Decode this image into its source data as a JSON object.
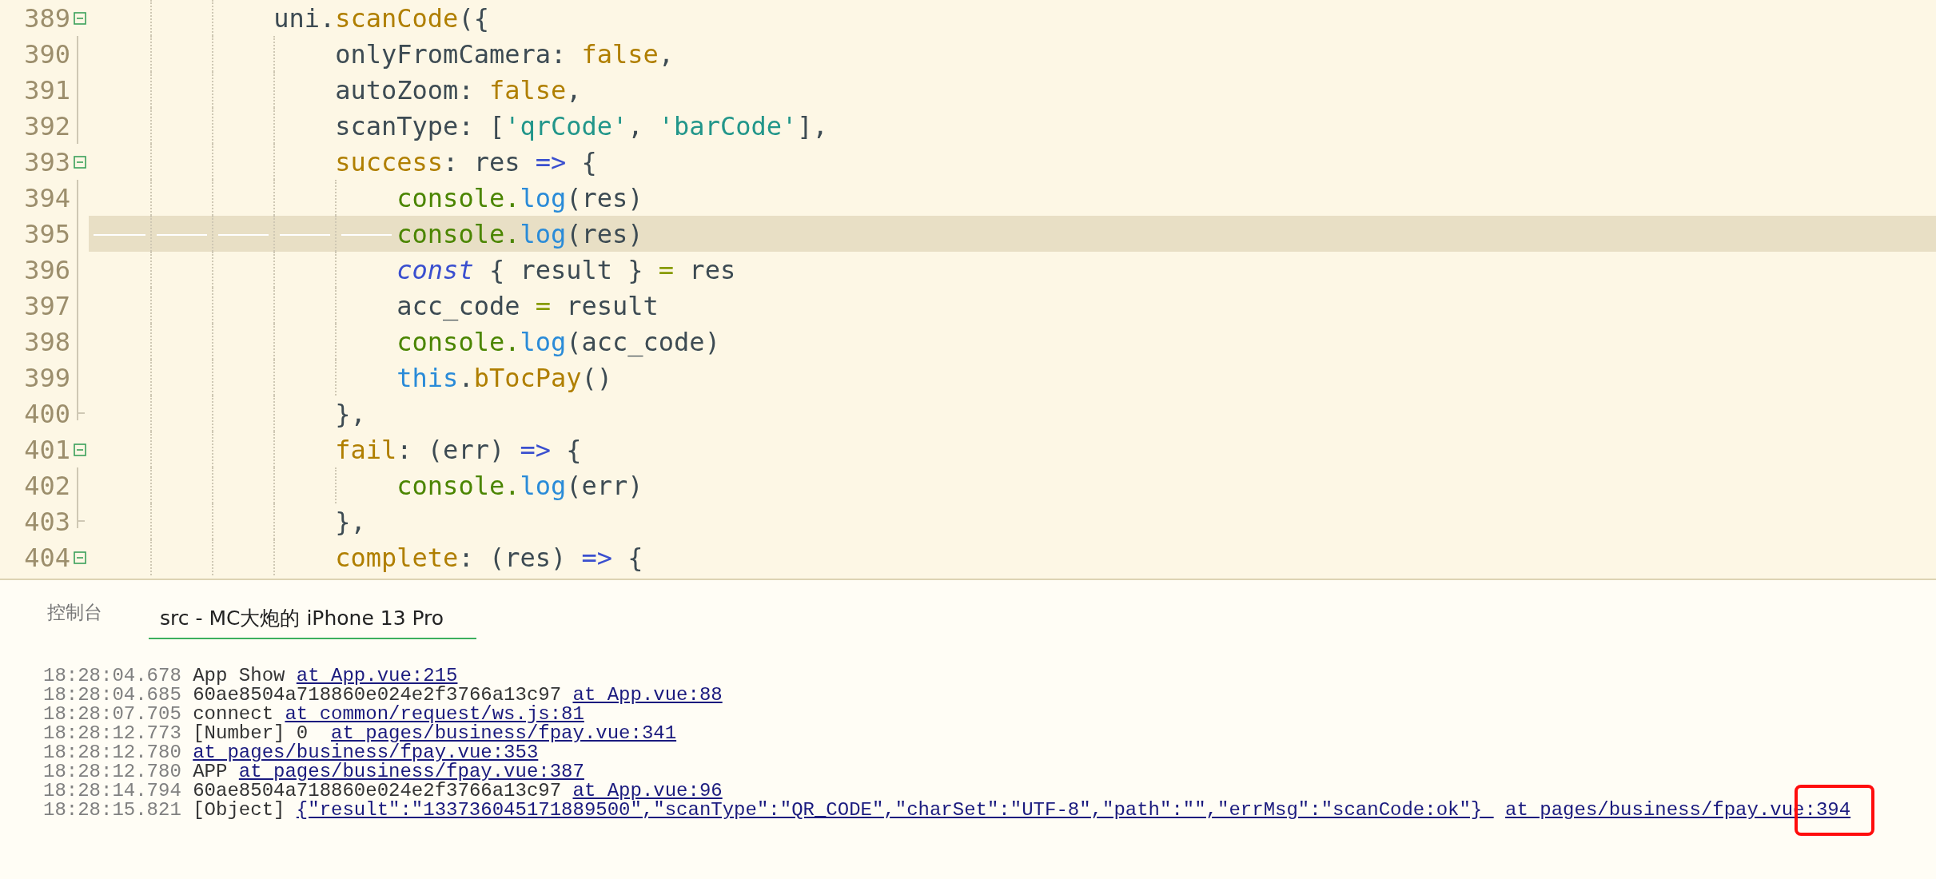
{
  "editor": {
    "lines": [
      {
        "number": "389",
        "foldable": true,
        "highlighted": false,
        "tokens": [
          {
            "t": "uni.",
            "kind": "plain"
          },
          {
            "t": "scanCode",
            "kind": "prop"
          },
          {
            "t": "({",
            "kind": "plain"
          }
        ],
        "children": [
          {
            "number": "390",
            "foldable": false,
            "highlighted": false,
            "tokens": [
              {
                "t": "onlyFromCamera: ",
                "kind": "plain"
              },
              {
                "t": "false",
                "kind": "prop"
              },
              {
                "t": ",",
                "kind": "plain"
              }
            ]
          },
          {
            "number": "391",
            "foldable": false,
            "highlighted": false,
            "tokens": [
              {
                "t": "autoZoom: ",
                "kind": "plain"
              },
              {
                "t": "false",
                "kind": "prop"
              },
              {
                "t": ",",
                "kind": "plain"
              }
            ]
          },
          {
            "number": "392",
            "foldable": false,
            "highlighted": false,
            "tokens": [
              {
                "t": "scanType: [",
                "kind": "plain"
              },
              {
                "t": "'qrCode'",
                "kind": "string"
              },
              {
                "t": ", ",
                "kind": "plain"
              },
              {
                "t": "'barCode'",
                "kind": "string"
              },
              {
                "t": "],",
                "kind": "plain"
              }
            ]
          },
          {
            "number": "393",
            "foldable": true,
            "highlighted": false,
            "tokens": [
              {
                "t": "success",
                "kind": "prop"
              },
              {
                "t": ": res ",
                "kind": "plain"
              },
              {
                "t": "=>",
                "kind": "arrow"
              },
              {
                "t": " {",
                "kind": "plain"
              }
            ],
            "children": [
              {
                "number": "394",
                "foldable": false,
                "highlighted": false,
                "tokens": [
                  {
                    "t": "console.",
                    "kind": "object"
                  },
                  {
                    "t": "log",
                    "kind": "func"
                  },
                  {
                    "t": "(res)",
                    "kind": "plain"
                  }
                ]
              },
              {
                "number": "395",
                "foldable": false,
                "highlighted": true,
                "tokens": [
                  {
                    "t": "console.",
                    "kind": "object"
                  },
                  {
                    "t": "log",
                    "kind": "func"
                  },
                  {
                    "t": "(res)",
                    "kind": "plain"
                  }
                ]
              },
              {
                "number": "396",
                "foldable": false,
                "highlighted": false,
                "tokens": [
                  {
                    "t": "const",
                    "kind": "keyword"
                  },
                  {
                    "t": " { result } ",
                    "kind": "plain"
                  },
                  {
                    "t": "=",
                    "kind": "op"
                  },
                  {
                    "t": " res",
                    "kind": "plain"
                  }
                ]
              },
              {
                "number": "397",
                "foldable": false,
                "highlighted": false,
                "tokens": [
                  {
                    "t": "acc_code ",
                    "kind": "plain"
                  },
                  {
                    "t": "=",
                    "kind": "op"
                  },
                  {
                    "t": " result",
                    "kind": "plain"
                  }
                ]
              },
              {
                "number": "398",
                "foldable": false,
                "highlighted": false,
                "tokens": [
                  {
                    "t": "console.",
                    "kind": "object"
                  },
                  {
                    "t": "log",
                    "kind": "func"
                  },
                  {
                    "t": "(acc_code)",
                    "kind": "plain"
                  }
                ]
              },
              {
                "number": "399",
                "foldable": false,
                "highlighted": false,
                "tokens": [
                  {
                    "t": "this",
                    "kind": "func"
                  },
                  {
                    "t": ".",
                    "kind": "plain"
                  },
                  {
                    "t": "bTocPay",
                    "kind": "prop"
                  },
                  {
                    "t": "()",
                    "kind": "plain"
                  }
                ]
              }
            ]
          },
          {
            "number": "400",
            "foldable": false,
            "fold_end": true,
            "highlighted": false,
            "tokens": [
              {
                "t": "},",
                "kind": "plain"
              }
            ]
          },
          {
            "number": "401",
            "foldable": true,
            "highlighted": false,
            "tokens": [
              {
                "t": "fail",
                "kind": "prop"
              },
              {
                "t": ": (err) ",
                "kind": "plain"
              },
              {
                "t": "=>",
                "kind": "arrow"
              },
              {
                "t": " {",
                "kind": "plain"
              }
            ],
            "children": [
              {
                "number": "402",
                "foldable": false,
                "highlighted": false,
                "tokens": [
                  {
                    "t": "console.",
                    "kind": "object"
                  },
                  {
                    "t": "log",
                    "kind": "func"
                  },
                  {
                    "t": "(err)",
                    "kind": "plain"
                  }
                ]
              }
            ]
          },
          {
            "number": "403",
            "foldable": false,
            "fold_end": true,
            "highlighted": false,
            "tokens": [
              {
                "t": "},",
                "kind": "plain"
              }
            ]
          },
          {
            "number": "404",
            "foldable": true,
            "highlighted": false,
            "tokens": [
              {
                "t": "complete",
                "kind": "prop"
              },
              {
                "t": ": (res) ",
                "kind": "plain"
              },
              {
                "t": "=>",
                "kind": "arrow"
              },
              {
                "t": " {",
                "kind": "plain"
              }
            ]
          }
        ]
      }
    ]
  },
  "console": {
    "title": "控制台",
    "tabs": [
      {
        "label": "src - MC大炮的 iPhone 13 Pro",
        "selected": true
      }
    ],
    "entries": [
      {
        "time": "18:28:04.678",
        "parts": [
          {
            "t": "App Show",
            "kind": "text"
          },
          {
            "t": "at App.vue:215",
            "kind": "link"
          }
        ]
      },
      {
        "time": "18:28:04.685",
        "parts": [
          {
            "t": "60ae8504a718860e024e2f3766a13c97",
            "kind": "text"
          },
          {
            "t": "at App.vue:88",
            "kind": "link"
          }
        ]
      },
      {
        "time": "18:28:07.705",
        "parts": [
          {
            "t": "connect",
            "kind": "text"
          },
          {
            "t": "at common/request/ws.js:81",
            "kind": "link"
          }
        ]
      },
      {
        "time": "18:28:12.773",
        "parts": [
          {
            "t": "[Number] 0 ",
            "kind": "text"
          },
          {
            "t": "at pages/business/fpay.vue:341",
            "kind": "link"
          }
        ]
      },
      {
        "time": "18:28:12.780",
        "parts": [
          {
            "t": "at pages/business/fpay.vue:353",
            "kind": "link"
          }
        ]
      },
      {
        "time": "18:28:12.780",
        "parts": [
          {
            "t": "APP",
            "kind": "text"
          },
          {
            "t": "at pages/business/fpay.vue:387",
            "kind": "link"
          }
        ]
      },
      {
        "time": "18:28:14.794",
        "parts": [
          {
            "t": "60ae8504a718860e024e2f3766a13c97",
            "kind": "text"
          },
          {
            "t": "at App.vue:96",
            "kind": "link"
          }
        ]
      },
      {
        "time": "18:28:15.821",
        "parts": [
          {
            "t": "[Object]",
            "kind": "text"
          },
          {
            "t": "{\"result\":\"133736045171889500\",\"scanType\":\"QR_CODE\",\"charSet\":\"UTF-8\",\"path\":\"\",\"errMsg\":\"scanCode:ok\"} ",
            "kind": "link"
          },
          {
            "t": "at pages/business/fpay.vue:394",
            "kind": "link",
            "annotated": true
          }
        ]
      }
    ]
  }
}
